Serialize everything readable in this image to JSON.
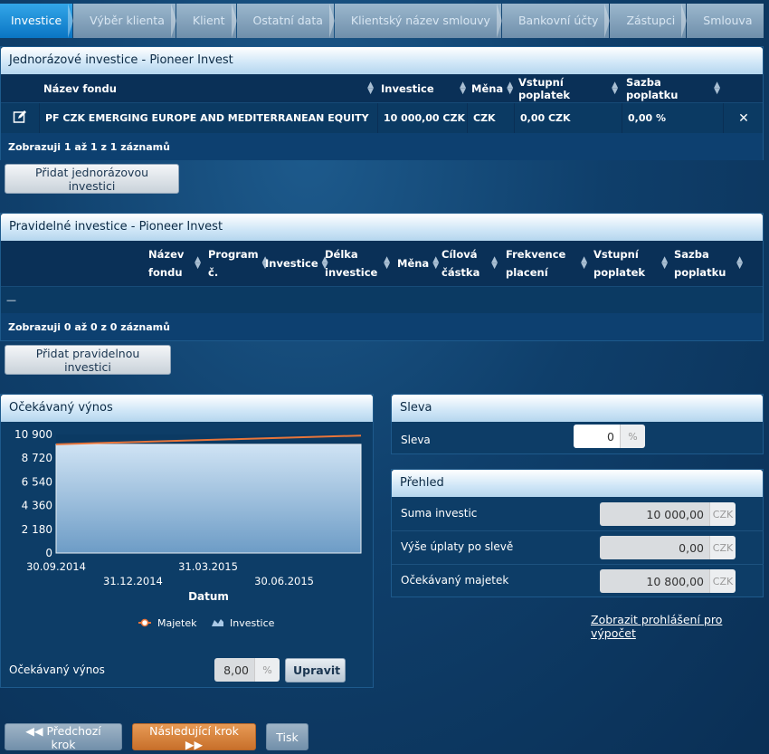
{
  "tabs": [
    "Investice",
    "Výběr klienta",
    "Klient",
    "Ostatní data",
    "Klientský název smlouvy",
    "Bankovní účty",
    "Zástupci",
    "Smlouva"
  ],
  "single": {
    "title": "Jednorázové investice - Pioneer Invest",
    "columns": [
      "Název fondu",
      "Investice",
      "Měna",
      "Vstupní poplatek",
      "Sazba poplatku"
    ],
    "row": {
      "fund": "PF CZK EMERGING EUROPE AND MEDITERRANEAN EQUITY",
      "investment": "10 000,00 CZK",
      "currency": "CZK",
      "entry_fee": "0,00 CZK",
      "fee_rate": "0,00 %"
    },
    "info": "Zobrazuji 1 až 1 z 1 záznamů",
    "add_button": "Přidat jednorázovou investici"
  },
  "regular": {
    "title": "Pravidelné investice - Pioneer Invest",
    "columns": [
      [
        "Název",
        "fondu"
      ],
      [
        "Program",
        "č."
      ],
      [
        "Investice",
        ""
      ],
      [
        "Délka",
        "investice"
      ],
      [
        "Měna",
        ""
      ],
      [
        "Cílová",
        "částka"
      ],
      [
        "Frekvence",
        "placení"
      ],
      [
        "Vstupní",
        "poplatek"
      ],
      [
        "Sazba",
        "poplatku"
      ]
    ],
    "empty_row": "—",
    "info": "Zobrazuji 0 až 0 z 0 záznamů",
    "add_button": "Přidat pravidelnou investici"
  },
  "yield": {
    "title": "Očekávaný výnos",
    "label": "Očekávaný výnos",
    "value": "8,00",
    "unit": "%",
    "edit_button": "Upravit"
  },
  "chart_data": {
    "type": "area",
    "xlabel": "Datum",
    "ylabel": "",
    "yticks": [
      "0",
      "2 180",
      "4 360",
      "6 540",
      "8 720",
      "10 900"
    ],
    "ylim": [
      0,
      10900
    ],
    "xticks": [
      "30.09.2014",
      "31.12.2014",
      "31.03.2015",
      "30.06.2015"
    ],
    "x_range": [
      "30.09.2014",
      "30.09.2015"
    ],
    "series": [
      {
        "name": "Majetek",
        "kind": "line",
        "color": "#e8753a",
        "x": [
          "30.09.2014",
          "30.09.2015"
        ],
        "values": [
          10000,
          10800
        ]
      },
      {
        "name": "Investice",
        "kind": "area",
        "color": "#a9c9e6",
        "x": [
          "30.09.2014",
          "30.09.2015"
        ],
        "values": [
          10000,
          10000
        ]
      }
    ],
    "legend": "bottom"
  },
  "discount": {
    "title": "Sleva",
    "label": "Sleva",
    "value": "0",
    "unit": "%"
  },
  "overview": {
    "title": "Přehled",
    "rows": [
      {
        "label": "Suma investic",
        "value": "10 000,00",
        "unit": "CZK"
      },
      {
        "label": "Výše úplaty po slevě",
        "value": "0,00",
        "unit": "CZK"
      },
      {
        "label": "Očekávaný majetek",
        "value": "10 800,00",
        "unit": "CZK"
      }
    ],
    "link": "Zobrazit prohlášení pro výpočet"
  },
  "nav": {
    "prev": "Předchozí krok",
    "next": "Následující krok",
    "print": "Tisk"
  }
}
